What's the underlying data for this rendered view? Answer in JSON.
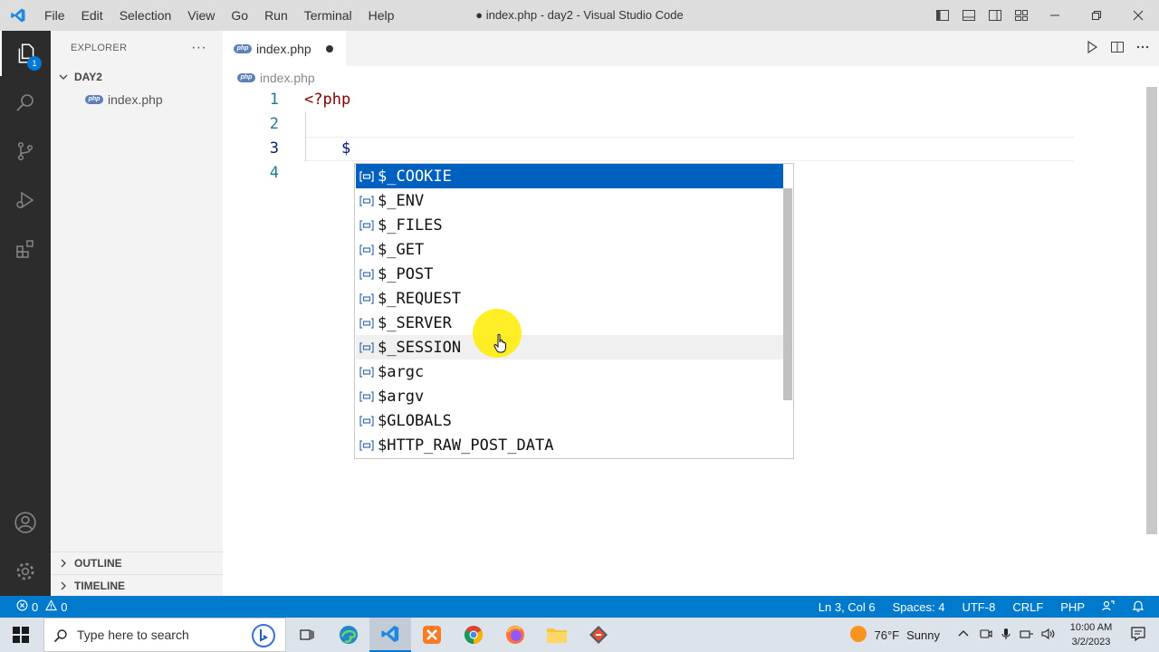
{
  "titlebar": {
    "menu": [
      "File",
      "Edit",
      "Selection",
      "View",
      "Go",
      "Run",
      "Terminal",
      "Help"
    ],
    "title": "● index.php - day2 - Visual Studio Code",
    "window_controls": [
      "minimize",
      "restore",
      "close"
    ]
  },
  "activitybar": {
    "explorer_badge": "1",
    "items": [
      "explorer-icon",
      "search-icon",
      "source-control-icon",
      "run-debug-icon",
      "extensions-icon",
      "account-icon",
      "settings-icon"
    ]
  },
  "sidebar": {
    "title": "EXPLORER",
    "more": "···",
    "folder": "DAY2",
    "file_badge": "php",
    "file": "index.php",
    "outline": "OUTLINE",
    "timeline": "TIMELINE"
  },
  "tab": {
    "badge": "php",
    "label": "index.php"
  },
  "breadcrumb": {
    "badge": "php",
    "file": "index.php"
  },
  "editor": {
    "lines": [
      {
        "number": "1",
        "code": "<?php"
      },
      {
        "number": "2",
        "code": ""
      },
      {
        "number": "3",
        "code": "    $"
      },
      {
        "number": "4",
        "code": ""
      }
    ]
  },
  "suggestions": {
    "selected_index": 0,
    "hover_index": 7,
    "items": [
      "$_COOKIE",
      "$_ENV",
      "$_FILES",
      "$_GET",
      "$_POST",
      "$_REQUEST",
      "$_SERVER",
      "$_SESSION",
      "$argc",
      "$argv",
      "$GLOBALS",
      "$HTTP_RAW_POST_DATA"
    ]
  },
  "statusbar": {
    "errors": "0",
    "warnings": "0",
    "position": "Ln 3, Col 6",
    "spaces": "Spaces: 4",
    "encoding": "UTF-8",
    "eol": "CRLF",
    "language": "PHP"
  },
  "taskbar": {
    "search_placeholder": "Type here to search",
    "weather_temp": "76°F",
    "weather_text": "Sunny",
    "time": "10:00 AM",
    "date": "3/2/2023"
  },
  "colors": {
    "statusbar": "#007acc",
    "selection": "#0060c0",
    "activitybar": "#2c2c2c",
    "cursor_highlight": "#ffec00"
  }
}
